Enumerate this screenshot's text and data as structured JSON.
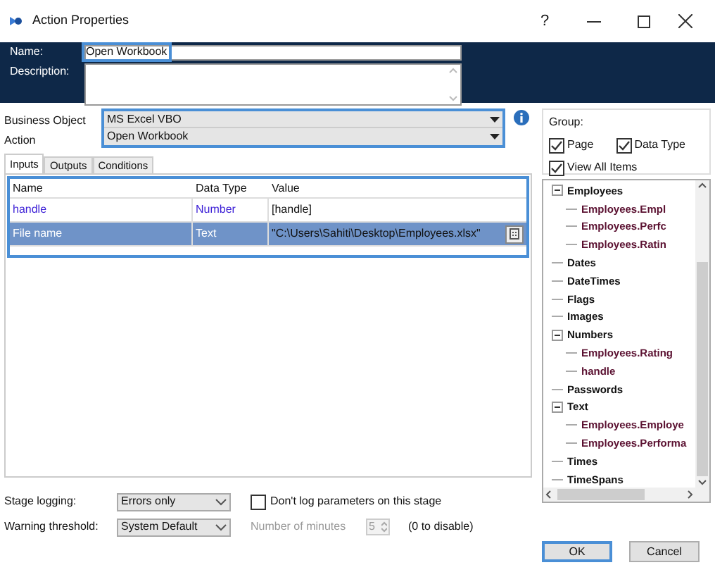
{
  "window": {
    "title": "Action Properties",
    "controls": [
      "?"
    ]
  },
  "name": {
    "label": "Name:",
    "value": "Open Workbook"
  },
  "description": {
    "label": "Description:"
  },
  "business_object": {
    "label": "Business Object",
    "value": "MS Excel VBO"
  },
  "action": {
    "label": "Action",
    "value": "Open Workbook"
  },
  "tabs": [
    {
      "label": "Inputs",
      "selected": true
    },
    {
      "label": "Outputs",
      "selected": false
    },
    {
      "label": "Conditions",
      "selected": false
    }
  ],
  "table": {
    "columns": [
      "Name",
      "Data Type",
      "Value"
    ],
    "rows": [
      {
        "name": "handle",
        "data_type": "Number",
        "value": "[handle]",
        "selected": false
      },
      {
        "name": "File name",
        "data_type": "Text",
        "value": "\"C:\\Users\\Sahiti\\Desktop\\Employees.xlsx\"",
        "selected": true
      }
    ]
  },
  "stage_logging": {
    "label": "Stage logging:",
    "value": "Errors only"
  },
  "dont_log": {
    "label": "Don't log parameters on this stage",
    "checked": false
  },
  "warning_threshold": {
    "label": "Warning threshold:",
    "value": "System Default"
  },
  "minutes": {
    "label": "Number of minutes",
    "value": "5",
    "hint": "(0 to disable)"
  },
  "group": {
    "label": "Group:",
    "options": [
      {
        "label": "Page",
        "checked": true
      },
      {
        "label": "Data Type",
        "checked": true
      },
      {
        "label": "View All Items",
        "checked": true
      }
    ]
  },
  "tree": [
    {
      "label": "Employees",
      "expanded": true,
      "children": [
        {
          "label": "Employees.Empl"
        },
        {
          "label": "Employees.Perfc"
        },
        {
          "label": "Employees.Ratin"
        }
      ]
    },
    {
      "label": "Dates"
    },
    {
      "label": "DateTimes"
    },
    {
      "label": "Flags"
    },
    {
      "label": "Images"
    },
    {
      "label": "Numbers",
      "expanded": true,
      "children": [
        {
          "label": "Employees.Rating"
        },
        {
          "label": "handle"
        }
      ]
    },
    {
      "label": "Passwords"
    },
    {
      "label": "Text",
      "expanded": true,
      "children": [
        {
          "label": "Employees.Employe"
        },
        {
          "label": "Employees.Performa"
        }
      ]
    },
    {
      "label": "Times"
    },
    {
      "label": "TimeSpans"
    }
  ],
  "buttons": [
    "OK",
    "Cancel"
  ]
}
